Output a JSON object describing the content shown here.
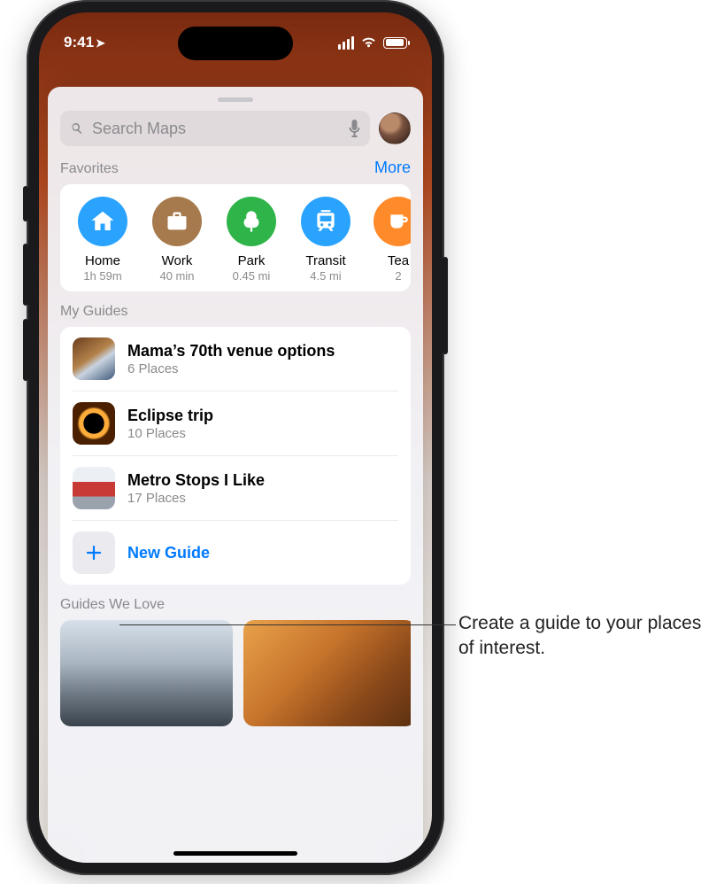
{
  "status": {
    "time": "9:41"
  },
  "search": {
    "placeholder": "Search Maps"
  },
  "favorites": {
    "title": "Favorites",
    "more_label": "More",
    "items": [
      {
        "name": "Home",
        "sub": "1h 59m",
        "icon": "house",
        "color": "#2aa3ff"
      },
      {
        "name": "Work",
        "sub": "40 min",
        "icon": "briefcase",
        "color": "#a67a4d"
      },
      {
        "name": "Park",
        "sub": "0.45 mi",
        "icon": "tree",
        "color": "#2fb44a"
      },
      {
        "name": "Transit",
        "sub": "4.5 mi",
        "icon": "tram",
        "color": "#2aa3ff"
      },
      {
        "name": "Tea",
        "sub": "2",
        "icon": "cup",
        "color": "#ff8a2a"
      }
    ]
  },
  "my_guides": {
    "title": "My Guides",
    "items": [
      {
        "title": "Mama’s 70th venue options",
        "sub": "6 Places",
        "thumb_css": "linear-gradient(145deg,#6b3d1d 0%,#b3824a 45%,#c9d3e0 60%,#3f5a7a 100%)"
      },
      {
        "title": "Eclipse trip",
        "sub": "10 Places",
        "thumb_css": "radial-gradient(circle at 50% 50%, #000 0 34%, #ffad3a 35% 48%, #4a2000 55% 100%)"
      },
      {
        "title": "Metro Stops I Like",
        "sub": "17 Places",
        "thumb_css": "linear-gradient(180deg,#eceff4 0 35%, #c73a35 35% 70%, #9aa2ad 70% 100%)"
      }
    ],
    "new_guide_label": "New Guide"
  },
  "guides_we_love": {
    "title": "Guides We Love",
    "cards": [
      {
        "bg": "linear-gradient(180deg,#d7e0ea 0%, #aab6c2 40%, #6d7884 70%, #3b434c 100%)"
      },
      {
        "bg": "linear-gradient(135deg,#e9a24c 0%, #c7742b 40%, #8c4a1a 70%, #5a2f10 100%)"
      }
    ]
  },
  "callout": {
    "text": "Create a guide to your places of interest."
  }
}
